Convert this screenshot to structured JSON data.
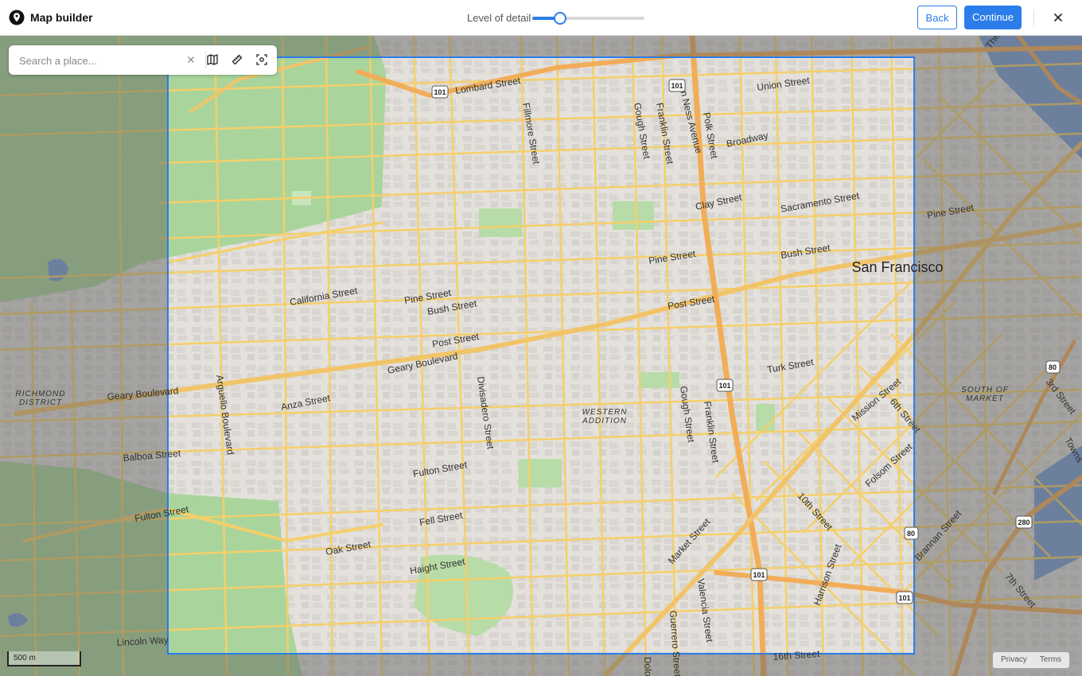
{
  "header": {
    "title": "Map builder",
    "level_label": "Level of detail",
    "level_value": 0.25,
    "back_label": "Back",
    "continue_label": "Continue"
  },
  "search": {
    "placeholder": "Search a place..."
  },
  "map": {
    "city_label": "San Francisco",
    "districts": [
      {
        "line1": "RICHMOND",
        "line2": "DISTRICT"
      },
      {
        "line1": "WESTERN",
        "line2": "ADDITION"
      },
      {
        "line1": "SOUTH OF",
        "line2": "MARKET"
      }
    ],
    "streets": [
      "Lombard Street",
      "Union Street",
      "Fillmore Street",
      "Gough Street",
      "Franklin Street",
      "Van Ness Avenue",
      "Polk Street",
      "Broadway",
      "Clay Street",
      "Sacramento Street",
      "Pine Street",
      "Bush Street",
      "California Street",
      "Post Street",
      "Geary Boulevard",
      "Turk Street",
      "Anza Street",
      "Arguello Boulevard",
      "Divisadero Street",
      "Balboa Street",
      "Fulton Street",
      "Fell Street",
      "Oak Street",
      "Haight Street",
      "Market Street",
      "Valencia Street",
      "Guerrero Street",
      "Mission Street",
      "6th Street",
      "Folsom Street",
      "10th Street",
      "Harrison Street",
      "Brannan Street",
      "7th Street",
      "3rd Street",
      "16th Street",
      "Lincoln Way",
      "The Embarcadero",
      "Towns",
      "Dolo"
    ],
    "shields": [
      "101",
      "101",
      "101",
      "101",
      "101",
      "80",
      "80",
      "280"
    ]
  },
  "scale_label": "500 m",
  "footer": {
    "privacy": "Privacy",
    "terms": "Terms"
  },
  "colors": {
    "accent": "#2b7de9",
    "road": "#f5cf6a",
    "highway": "#f2ad59",
    "park": "#a9d59c",
    "water": "#7a9fd6",
    "base": "#e4e1dc"
  }
}
